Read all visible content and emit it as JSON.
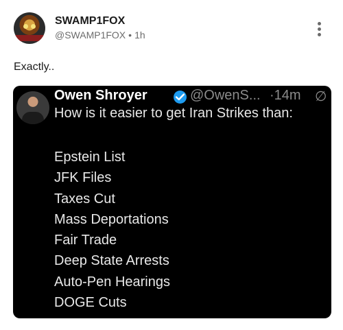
{
  "author": {
    "display_name": "SWAMP1FOX",
    "handle": "@SWAMP1FOX",
    "separator": "•",
    "time": "1h"
  },
  "caption": "Exactly..",
  "embedded_post": {
    "display_name": "Owen Shroyer",
    "handle": "@OwenS...",
    "time": "·14m",
    "text": "How is it easier to get Iran Strikes than:",
    "items": [
      "Epstein List",
      "JFK Files",
      "Taxes Cut",
      "Mass Deportations",
      "Fair Trade",
      "Deep State Arrests",
      "Auto-Pen Hearings",
      "DOGE Cuts"
    ]
  },
  "colors": {
    "embed_background": "#000000",
    "verified_badge": "#1d9bf0",
    "meta_text": "#6b6b6b"
  },
  "icons": {
    "more": "vertical-ellipsis-icon",
    "verified": "verified-check-icon",
    "grok": "grok-icon"
  }
}
